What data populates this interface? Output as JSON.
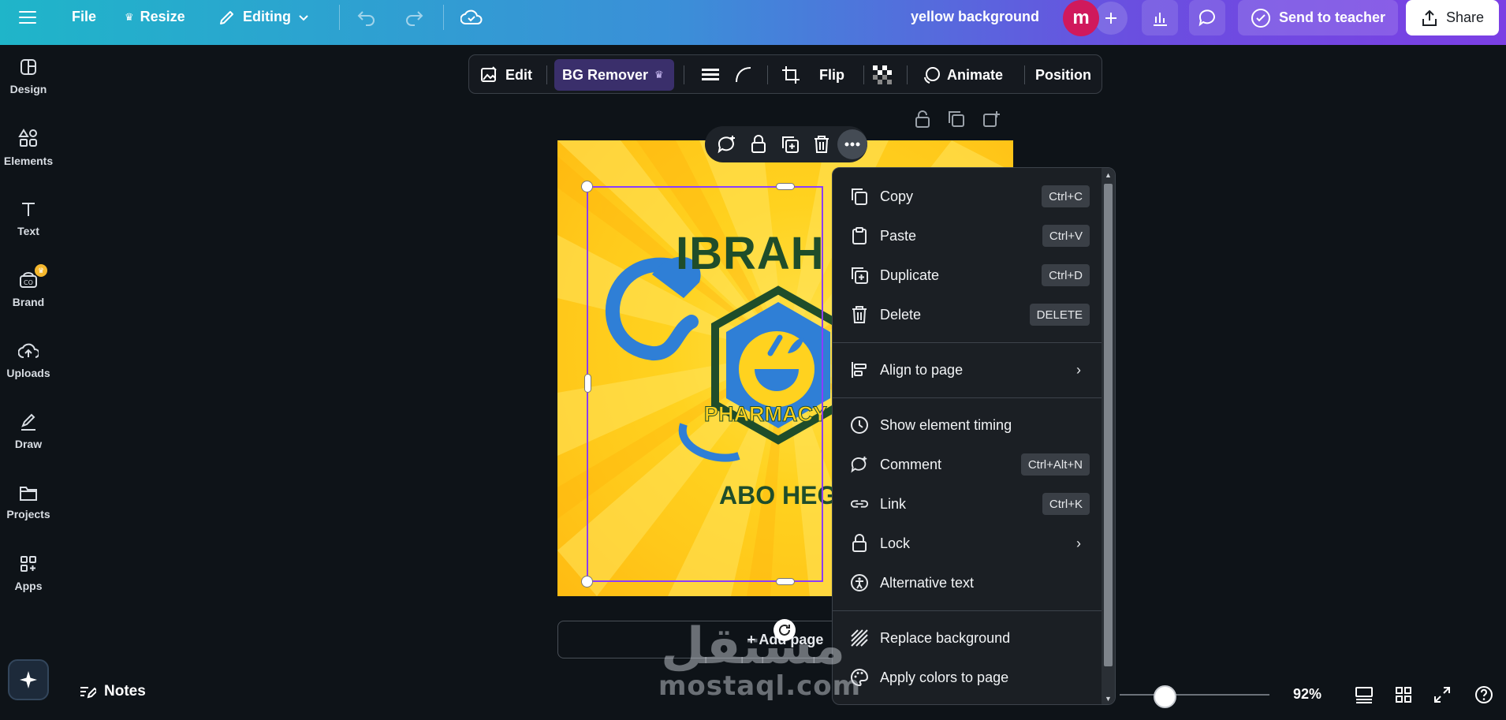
{
  "topbar": {
    "file": "File",
    "resize": "Resize",
    "editing": "Editing",
    "doc_title": "yellow background",
    "avatar": "m",
    "send_to_teacher": "Send to teacher",
    "share": "Share"
  },
  "rail": {
    "items": [
      {
        "label": "Design",
        "icon": "design-icon"
      },
      {
        "label": "Elements",
        "icon": "elements-icon"
      },
      {
        "label": "Text",
        "icon": "text-icon"
      },
      {
        "label": "Brand",
        "icon": "brand-icon"
      },
      {
        "label": "Uploads",
        "icon": "uploads-icon"
      },
      {
        "label": "Draw",
        "icon": "draw-icon"
      },
      {
        "label": "Projects",
        "icon": "projects-icon"
      },
      {
        "label": "Apps",
        "icon": "apps-icon"
      }
    ]
  },
  "toolbar": {
    "edit": "Edit",
    "bg_remover": "BG Remover",
    "flip": "Flip",
    "animate": "Animate",
    "position": "Position"
  },
  "canvas": {
    "logo_name": "IBRAH",
    "logo_pharmacy": "PHARMACY",
    "logo_bottom": "ABO HEGA",
    "add_page": "+ Add page"
  },
  "menu": {
    "items": [
      {
        "label": "Copy",
        "shortcut": "Ctrl+C",
        "icon": "copy-icon"
      },
      {
        "label": "Paste",
        "shortcut": "Ctrl+V",
        "icon": "paste-icon"
      },
      {
        "label": "Duplicate",
        "shortcut": "Ctrl+D",
        "icon": "duplicate-icon"
      },
      {
        "label": "Delete",
        "shortcut": "DELETE",
        "icon": "delete-icon"
      },
      {
        "label": "Align to page",
        "shortcut": "",
        "icon": "align-icon"
      },
      {
        "label": "Show element timing",
        "shortcut": "",
        "icon": "clock-icon"
      },
      {
        "label": "Comment",
        "shortcut": "Ctrl+Alt+N",
        "icon": "comment-icon"
      },
      {
        "label": "Link",
        "shortcut": "Ctrl+K",
        "icon": "link-icon"
      },
      {
        "label": "Lock",
        "shortcut": "",
        "icon": "lock-icon"
      },
      {
        "label": "Alternative text",
        "shortcut": "",
        "icon": "accessibility-icon"
      },
      {
        "label": "Replace background",
        "shortcut": "",
        "icon": "replace-background-icon"
      },
      {
        "label": "Apply colors to page",
        "shortcut": "",
        "icon": "palette-icon"
      }
    ]
  },
  "footer": {
    "notes": "Notes",
    "zoom": "92%",
    "zoom_fraction": 0.3
  },
  "watermark": {
    "arabic": "مستقل",
    "latin": "mostaql.com"
  },
  "colors": {
    "accent": "#7b3fe4",
    "avatar_bg": "#d0195c",
    "canvas_yellow": "#ffd21f",
    "logo_green": "#1f4d2a",
    "logo_blue": "#2f7fd6"
  }
}
